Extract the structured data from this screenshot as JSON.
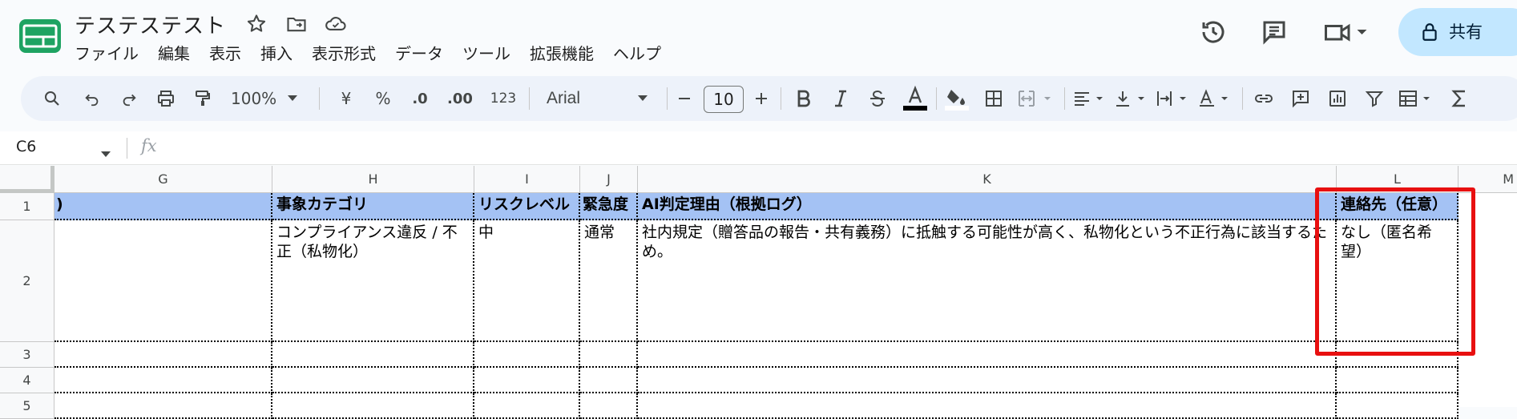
{
  "title_bar": {
    "doc_title": "テステステスト",
    "menu": [
      "ファイル",
      "編集",
      "表示",
      "挿入",
      "表示形式",
      "データ",
      "ツール",
      "拡張機能",
      "ヘルプ"
    ],
    "share_label": "共有"
  },
  "toolbar": {
    "zoom": "100%",
    "currency": "¥",
    "percent": "%",
    "dec_decrease": ".0",
    "dec_increase": ".00",
    "number_format": "123",
    "font": "Arial",
    "font_size": "10",
    "icons": [
      "search-icon",
      "undo-icon",
      "redo-icon",
      "print-icon",
      "paint-format-icon",
      "bold-icon",
      "italic-icon",
      "strikethrough-icon",
      "text-color-icon",
      "fill-color-icon",
      "borders-icon",
      "merge-cells-icon",
      "align-icon",
      "vertical-align-icon",
      "text-wrap-icon",
      "text-rotation-icon",
      "link-icon",
      "comment-icon",
      "chart-icon",
      "filter-icon",
      "table-view-icon",
      "functions-icon"
    ]
  },
  "formula_bar": {
    "name_box": "C6",
    "fx": "fx"
  },
  "grid": {
    "columns": [
      "G",
      "H",
      "I",
      "J",
      "K",
      "L",
      "M"
    ],
    "rows": [
      "1",
      "2",
      "3",
      "4",
      "5"
    ],
    "header_row": {
      "g": ")",
      "h": "事象カテゴリ",
      "i": "リスクレベル",
      "j": "緊急度",
      "k": "AI判定理由（根拠ログ）",
      "l": "連絡先（任意）"
    },
    "row2": {
      "h": "コンプライアンス違反 / 不正（私物化）",
      "i": "中",
      "j": "通常",
      "k": "社内規定（贈答品の報告・共有義務）に抵触する可能性が高く、私物化という不正行為に該当するため。",
      "l": "なし（匿名希望）"
    }
  },
  "colors": {
    "header_fill": "#a4c2f4",
    "highlight": "#e81010",
    "share_bg": "#c2e7ff",
    "toolbar_bg": "#edf2fa"
  }
}
